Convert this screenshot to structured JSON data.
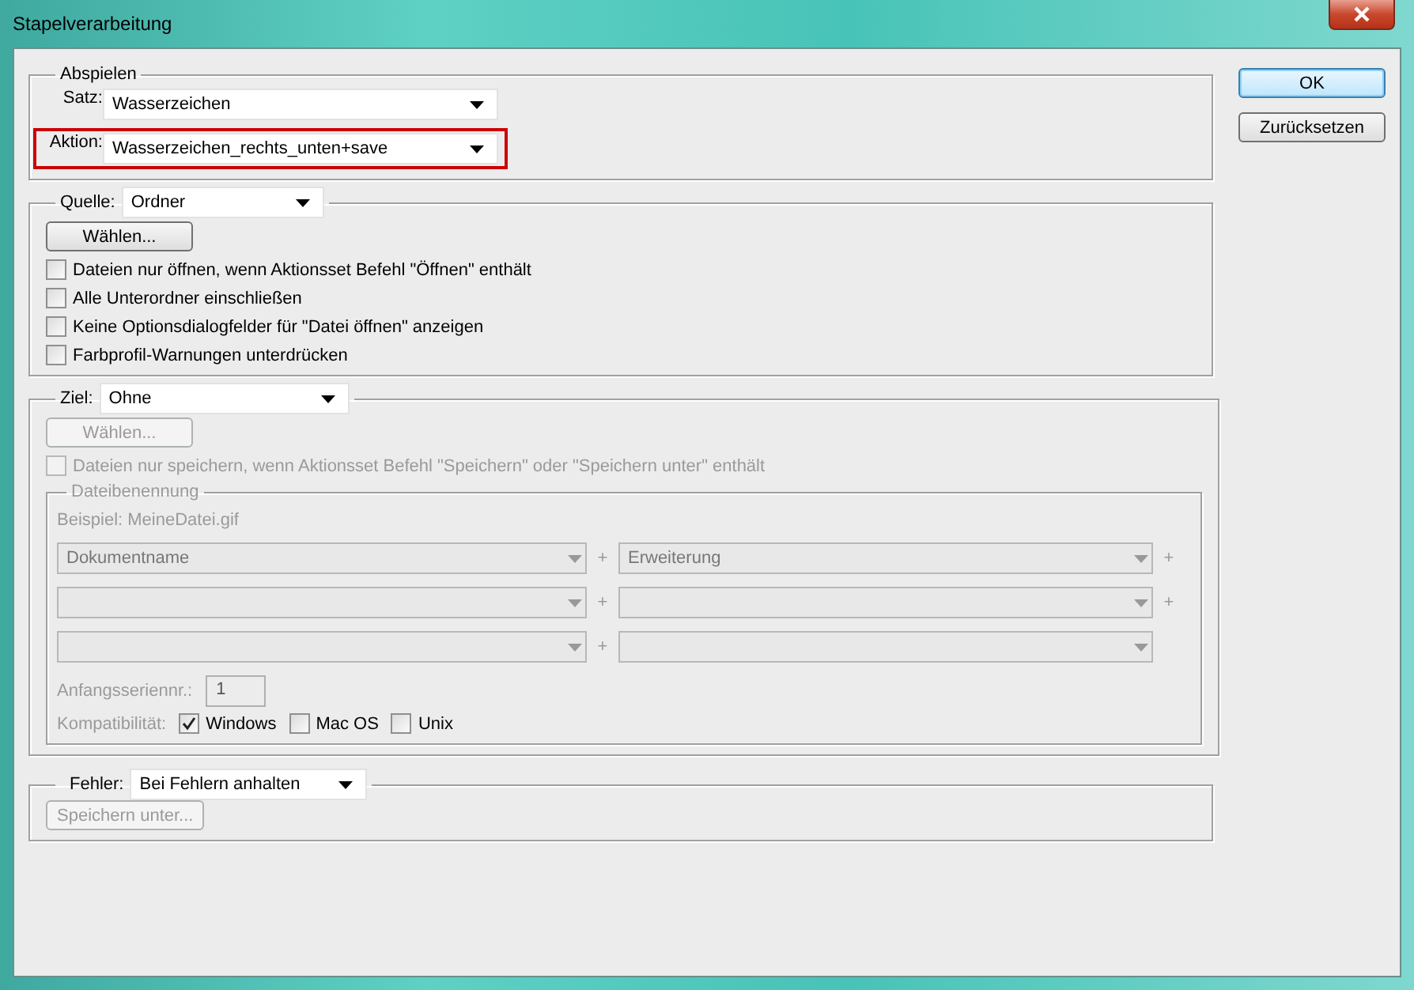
{
  "window": {
    "title": "Stapelverarbeitung"
  },
  "buttons": [
    {
      "label": "OK",
      "default": true
    },
    {
      "label": "Zurücksetzen",
      "default": false
    }
  ],
  "playback": {
    "legend": "Abspielen",
    "fields": [
      {
        "label": "Satz:",
        "value": "Wasserzeichen",
        "highlighted": false
      },
      {
        "label": "Aktion:",
        "value": "Wasserzeichen_rechts_unten+save",
        "highlighted": true
      }
    ]
  },
  "source": {
    "label": "Quelle:",
    "value": "Ordner",
    "choose_button": {
      "label": "Wählen...",
      "disabled": false
    },
    "options": [
      {
        "label": "Dateien nur öffnen, wenn Aktionsset Befehl \"Öffnen\" enthält",
        "checked": false,
        "disabled": false
      },
      {
        "label": "Alle Unterordner einschließen",
        "checked": false,
        "disabled": false
      },
      {
        "label": "Keine Optionsdialogfelder für \"Datei öffnen\" anzeigen",
        "checked": false,
        "disabled": false
      },
      {
        "label": "Farbprofil-Warnungen unterdrücken",
        "checked": false,
        "disabled": false
      }
    ]
  },
  "destination": {
    "label": "Ziel:",
    "value": "Ohne",
    "choose_button": {
      "label": "Wählen...",
      "disabled": true
    },
    "options": [
      {
        "label": "Dateien nur speichern, wenn Aktionsset Befehl \"Speichern\" oder \"Speichern unter\" enthält",
        "checked": false,
        "disabled": true
      }
    ],
    "file_naming": {
      "legend": "Dateibenennung",
      "disabled": true,
      "example": "Beispiel: MeineDatei.gif",
      "rows": [
        [
          {
            "value": "Dokumentname",
            "plus": "+"
          },
          {
            "value": "Erweiterung",
            "plus": "+"
          }
        ],
        [
          {
            "plus": "+"
          },
          {
            "plus": "+"
          }
        ],
        [
          {
            "plus": "+"
          },
          {}
        ]
      ],
      "serial": {
        "label": "Anfangsseriennr.:",
        "value": "1"
      },
      "compatibility": {
        "label": "Kompatibilität:",
        "options": [
          {
            "label": "Windows",
            "checked": true
          },
          {
            "label": "Mac OS",
            "checked": false
          },
          {
            "label": "Unix",
            "checked": false
          }
        ]
      }
    }
  },
  "errors": {
    "label": "Fehler:",
    "value": "Bei Fehlern anhalten",
    "save_button": {
      "label": "Speichern unter...",
      "disabled": true
    }
  }
}
